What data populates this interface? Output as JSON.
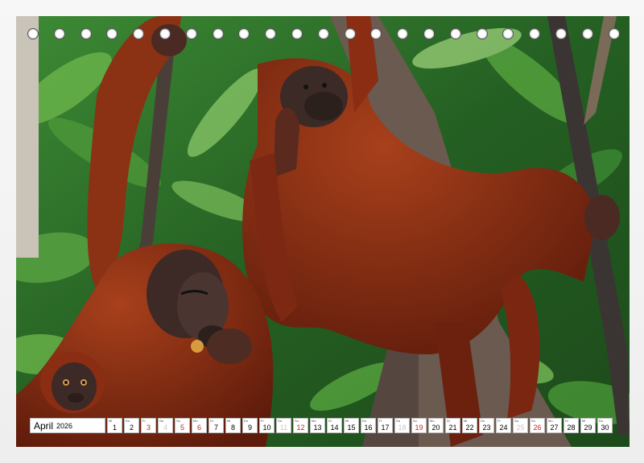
{
  "calendar": {
    "month": "April",
    "year": "2026",
    "days": [
      {
        "n": "1",
        "wd": "Mi"
      },
      {
        "n": "2",
        "wd": "Do"
      },
      {
        "n": "3",
        "wd": "Fr",
        "kind": "holiday"
      },
      {
        "n": "4",
        "wd": "Sa",
        "kind": "faint"
      },
      {
        "n": "5",
        "wd": "So",
        "kind": "sun"
      },
      {
        "n": "6",
        "wd": "Mo",
        "kind": "holiday"
      },
      {
        "n": "7",
        "wd": "Di"
      },
      {
        "n": "8",
        "wd": "Mi"
      },
      {
        "n": "9",
        "wd": "Do"
      },
      {
        "n": "10",
        "wd": "Fr"
      },
      {
        "n": "11",
        "wd": "Sa",
        "kind": "faint"
      },
      {
        "n": "12",
        "wd": "So",
        "kind": "sun"
      },
      {
        "n": "13",
        "wd": "Mo"
      },
      {
        "n": "14",
        "wd": "Di"
      },
      {
        "n": "15",
        "wd": "Mi"
      },
      {
        "n": "16",
        "wd": "Do"
      },
      {
        "n": "17",
        "wd": "Fr"
      },
      {
        "n": "18",
        "wd": "Sa",
        "kind": "faint"
      },
      {
        "n": "19",
        "wd": "So",
        "kind": "sun"
      },
      {
        "n": "20",
        "wd": "Mo"
      },
      {
        "n": "21",
        "wd": "Di"
      },
      {
        "n": "22",
        "wd": "Mi"
      },
      {
        "n": "23",
        "wd": "Do"
      },
      {
        "n": "24",
        "wd": "Fr"
      },
      {
        "n": "25",
        "wd": "Sa",
        "kind": "faint"
      },
      {
        "n": "26",
        "wd": "So",
        "kind": "sun"
      },
      {
        "n": "27",
        "wd": "Mo"
      },
      {
        "n": "28",
        "wd": "Di"
      },
      {
        "n": "29",
        "wd": "Mi"
      },
      {
        "n": "30",
        "wd": "Do"
      }
    ]
  },
  "photo": {
    "subject": "orangutans-in-jungle",
    "colors": {
      "fur": "#8a2d12",
      "fur_dark": "#5b1a0c",
      "face": "#3b2a26",
      "foliage": "#2f7a2c",
      "foliage_light": "#7fc25a",
      "trunk": "#6b5a4f"
    }
  },
  "binding": {
    "hole_count": 23
  }
}
